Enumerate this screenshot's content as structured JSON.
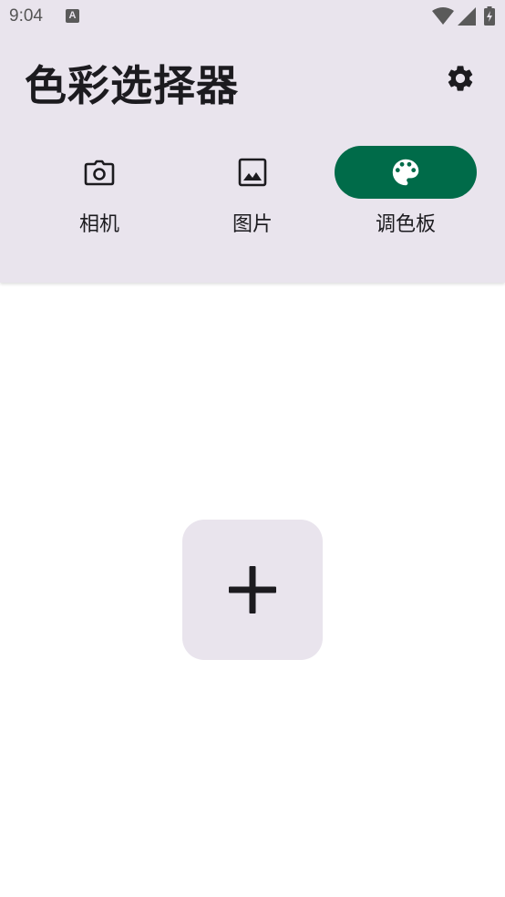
{
  "status_bar": {
    "time": "9:04",
    "notification_glyph": "A",
    "icons": [
      "notification-icon",
      "wifi-icon",
      "signal-icon",
      "battery-icon"
    ]
  },
  "app_bar": {
    "title": "色彩选择器",
    "settings_icon": "gear-icon"
  },
  "tabs": [
    {
      "label": "相机",
      "icon": "camera-icon",
      "active": false
    },
    {
      "label": "图片",
      "icon": "image-icon",
      "active": false
    },
    {
      "label": "调色板",
      "icon": "palette-icon",
      "active": true
    }
  ],
  "main": {
    "add_icon": "plus-icon"
  },
  "colors": {
    "header_background": "#e9e4ed",
    "active_tab": "#006b49",
    "content_background": "#ffffff",
    "add_button_background": "#e9e4ed",
    "text": "#1c1b1f"
  }
}
